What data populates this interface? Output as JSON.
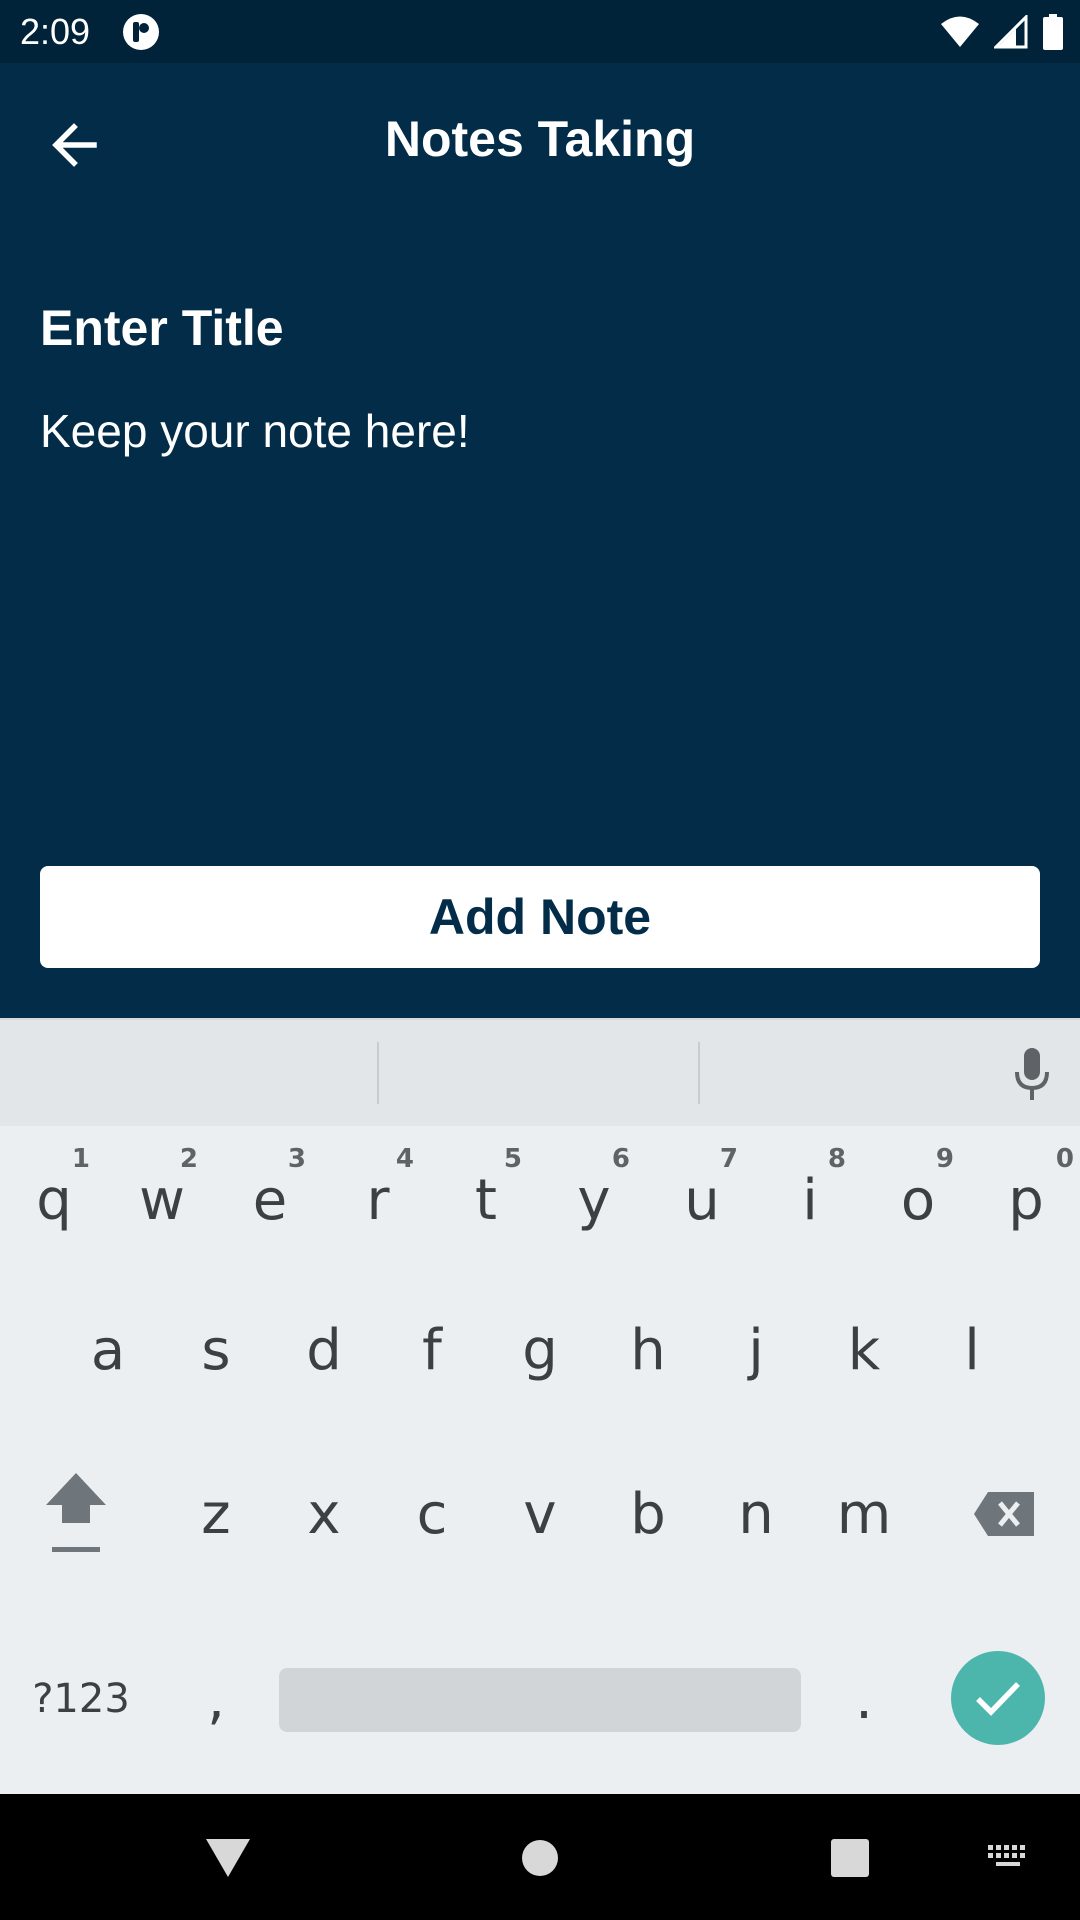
{
  "status_bar": {
    "time": "2:09"
  },
  "toolbar": {
    "title": "Notes Taking"
  },
  "form": {
    "title_placeholder": "Enter Title",
    "note_placeholder": "Keep your note here!",
    "add_button_label": "Add Note"
  },
  "keyboard": {
    "row1": [
      {
        "key": "q",
        "hint": "1"
      },
      {
        "key": "w",
        "hint": "2"
      },
      {
        "key": "e",
        "hint": "3"
      },
      {
        "key": "r",
        "hint": "4"
      },
      {
        "key": "t",
        "hint": "5"
      },
      {
        "key": "y",
        "hint": "6"
      },
      {
        "key": "u",
        "hint": "7"
      },
      {
        "key": "i",
        "hint": "8"
      },
      {
        "key": "o",
        "hint": "9"
      },
      {
        "key": "p",
        "hint": "0"
      }
    ],
    "row2": [
      "a",
      "s",
      "d",
      "f",
      "g",
      "h",
      "j",
      "k",
      "l"
    ],
    "row3": [
      "z",
      "x",
      "c",
      "v",
      "b",
      "n",
      "m"
    ],
    "symbols_key": "?123",
    "comma_key": ",",
    "period_key": "."
  },
  "colors": {
    "app_background": "#022c47",
    "status_bar": "#00233a",
    "keyboard_background": "#eceff1",
    "enter_key": "#4db6ac"
  },
  "icons": {
    "back": "arrow-left-icon",
    "mic": "microphone-icon",
    "shift": "shift-icon",
    "backspace": "backspace-icon",
    "enter": "checkmark-icon",
    "nav_back": "triangle-back-icon",
    "nav_home": "circle-home-icon",
    "nav_recents": "square-recents-icon",
    "nav_keyboard": "keyboard-icon"
  }
}
